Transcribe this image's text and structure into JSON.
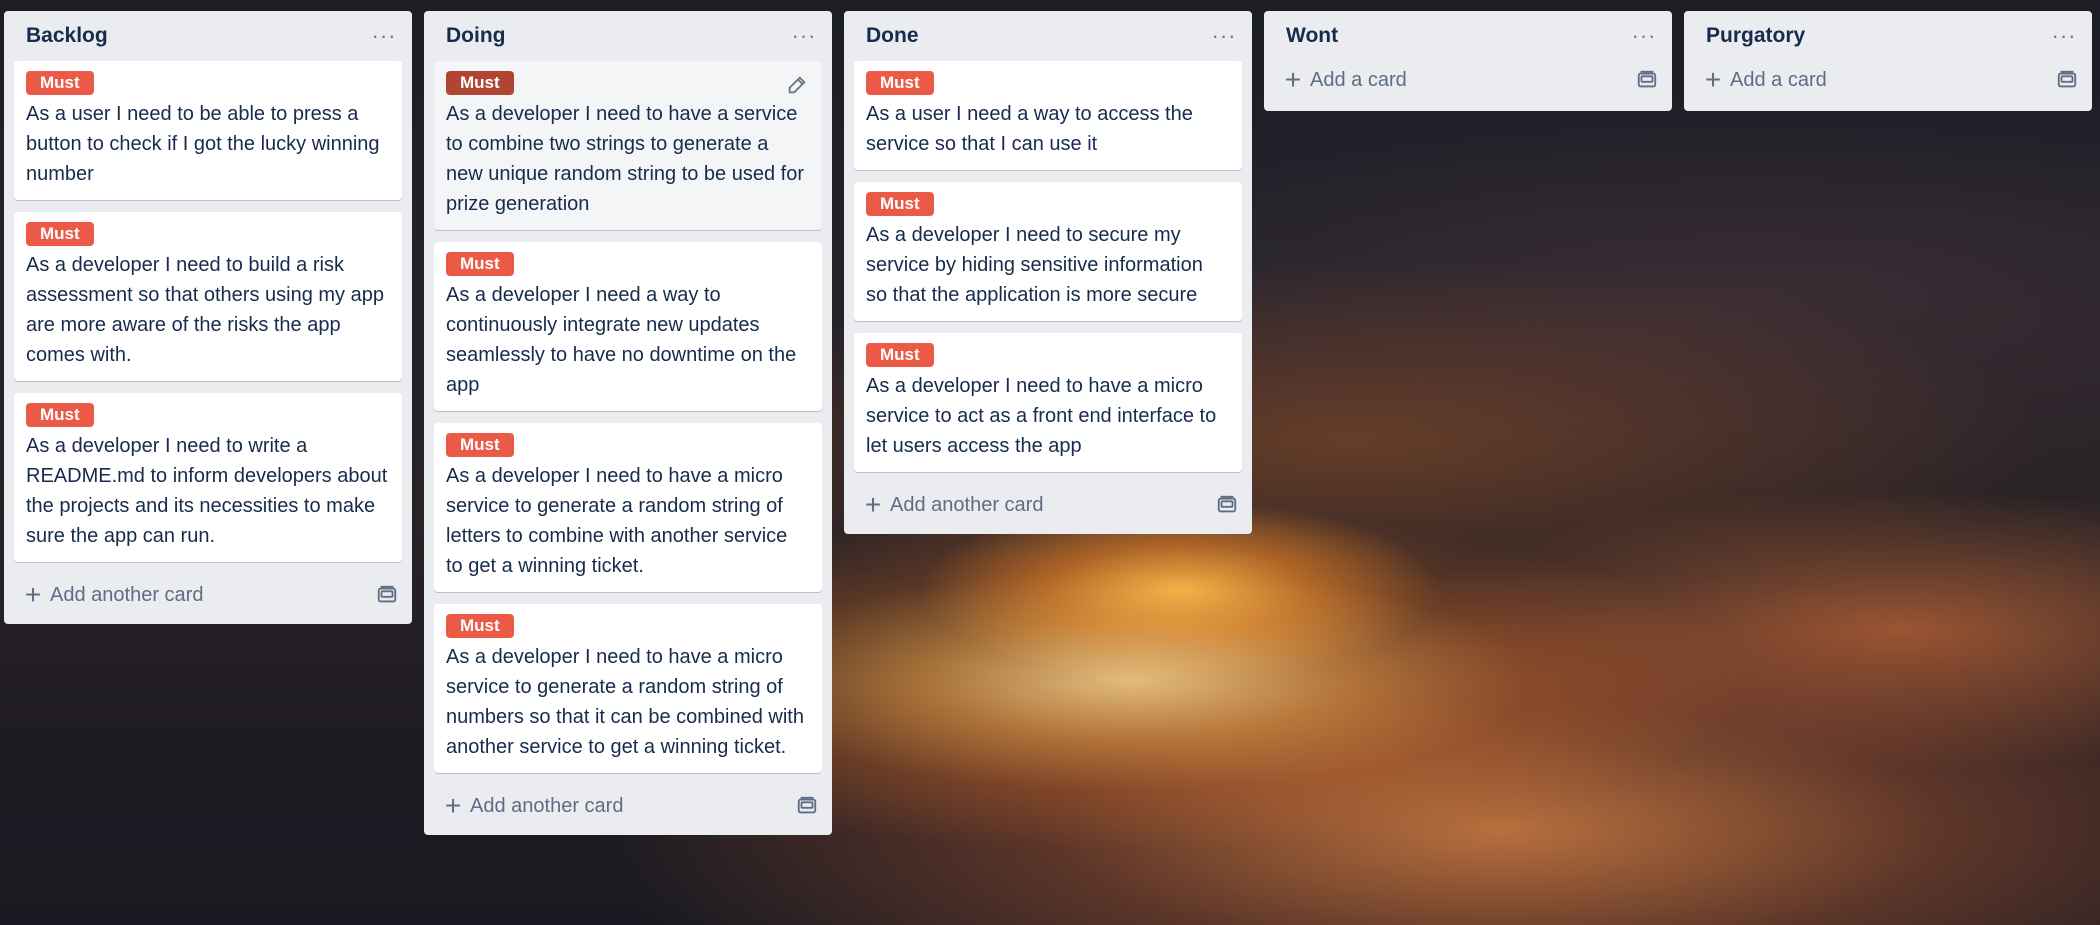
{
  "board": {
    "lists": [
      {
        "title": "Backlog",
        "cards": [
          {
            "label": "Must",
            "text": "As a user I need to be able to press a button to check if I got the lucky winning number"
          },
          {
            "label": "Must",
            "text": "As a developer I need to build a risk assessment so that others using my app are more aware of the risks the app comes with."
          },
          {
            "label": "Must",
            "text": "As a developer I need to write a README.md to inform developers about the projects and its necessities to make sure the app can run."
          }
        ],
        "add_label": "Add another card"
      },
      {
        "title": "Doing",
        "cards": [
          {
            "label": "Must",
            "text": "As a developer I need to have a service to combine two strings to generate a new unique random string to be used for prize generation"
          },
          {
            "label": "Must",
            "text": "As a developer I need a way to continuously integrate new updates seamlessly to have no downtime on the app"
          },
          {
            "label": "Must",
            "text": "As a developer I need to have a micro service to generate a random string of letters to combine with another service to get a winning ticket."
          },
          {
            "label": "Must",
            "text": "As a developer I need to have a micro service to generate a random string of numbers so that it can be combined with another service to get a winning ticket."
          }
        ],
        "add_label": "Add another card"
      },
      {
        "title": "Done",
        "cards": [
          {
            "label": "Must",
            "text": "As a user I need a way to access the service so that I can use it"
          },
          {
            "label": "Must",
            "text": "As a developer I need to secure my service by hiding sensitive information so that the application is more secure"
          },
          {
            "label": "Must",
            "text": "As a developer I need to have a micro service to act as a front end interface to let users access the app"
          }
        ],
        "add_label": "Add another card"
      },
      {
        "title": "Wont",
        "cards": [],
        "add_label": "Add a card"
      },
      {
        "title": "Purgatory",
        "cards": [],
        "add_label": "Add a card"
      }
    ]
  },
  "icons": {
    "list_menu": "more-horizontal-icon",
    "add": "plus-icon",
    "template": "card-template-icon",
    "edit": "pencil-icon"
  },
  "colors": {
    "label_must": "#eb5a46",
    "label_must_hover": "#b04632",
    "list_background": "#ebecf0",
    "text": "#172b4d"
  }
}
